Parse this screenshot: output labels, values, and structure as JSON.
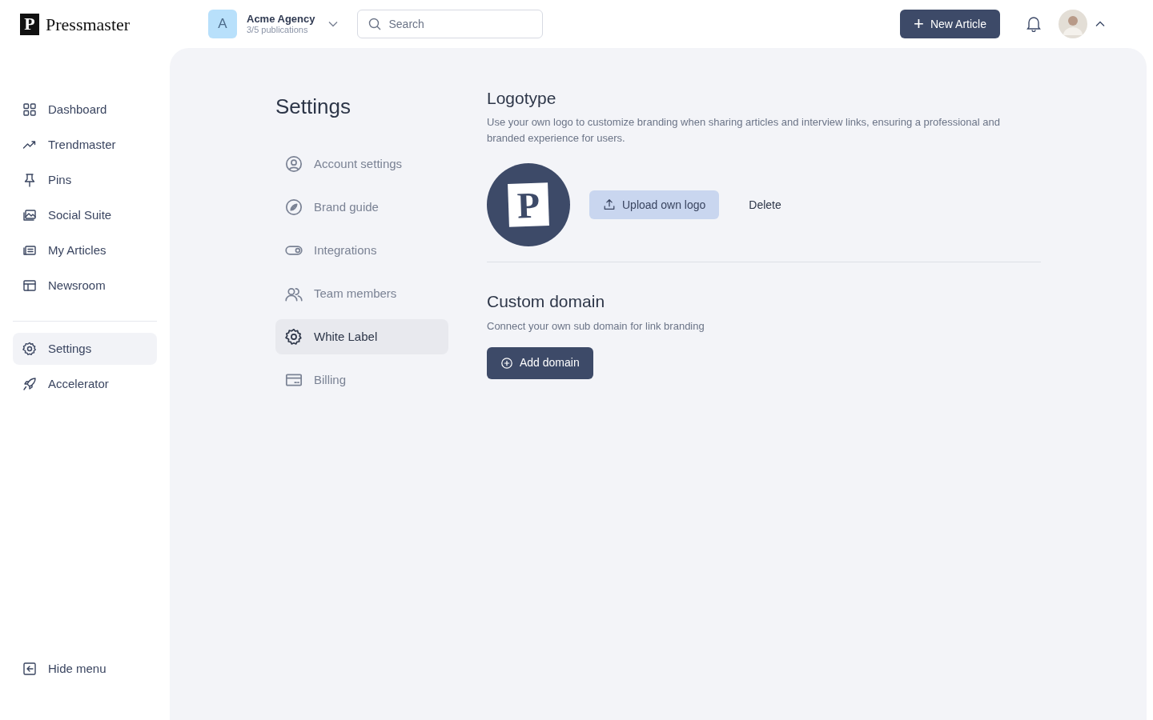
{
  "brand": {
    "mark": "P",
    "name": "Pressmaster"
  },
  "workspace": {
    "initial": "A",
    "name": "Acme Agency",
    "subtitle": "3/5 publications"
  },
  "search": {
    "placeholder": "Search"
  },
  "new_article_button": {
    "icon": "+",
    "label": "New Article"
  },
  "sidebar": {
    "items": [
      {
        "label": "Dashboard",
        "selected": false
      },
      {
        "label": "Trendmaster",
        "selected": false
      },
      {
        "label": "Pins",
        "selected": false
      },
      {
        "label": "Social Suite",
        "selected": false
      },
      {
        "label": "My Articles",
        "selected": false
      },
      {
        "label": "Newsroom",
        "selected": false
      }
    ],
    "bottom_items": [
      {
        "label": "Settings",
        "selected": true
      },
      {
        "label": "Accelerator",
        "selected": false
      }
    ],
    "hide_menu": "Hide menu"
  },
  "settings": {
    "title": "Settings",
    "items": [
      {
        "label": "Account settings",
        "selected": false
      },
      {
        "label": "Brand guide",
        "selected": false
      },
      {
        "label": "Integrations",
        "selected": false
      },
      {
        "label": "Team members",
        "selected": false
      },
      {
        "label": "White Label",
        "selected": true
      },
      {
        "label": "Billing",
        "selected": false
      }
    ]
  },
  "logotype": {
    "title": "Logotype",
    "description": "Use your own logo to customize branding when sharing articles and interview links, ensuring a professional and branded experience for users.",
    "logo_letter": "P",
    "upload_button": "Upload own logo",
    "delete_button": "Delete"
  },
  "custom_domain": {
    "title": "Custom domain",
    "description": "Connect your own sub domain for link branding",
    "add_button": "Add domain"
  }
}
